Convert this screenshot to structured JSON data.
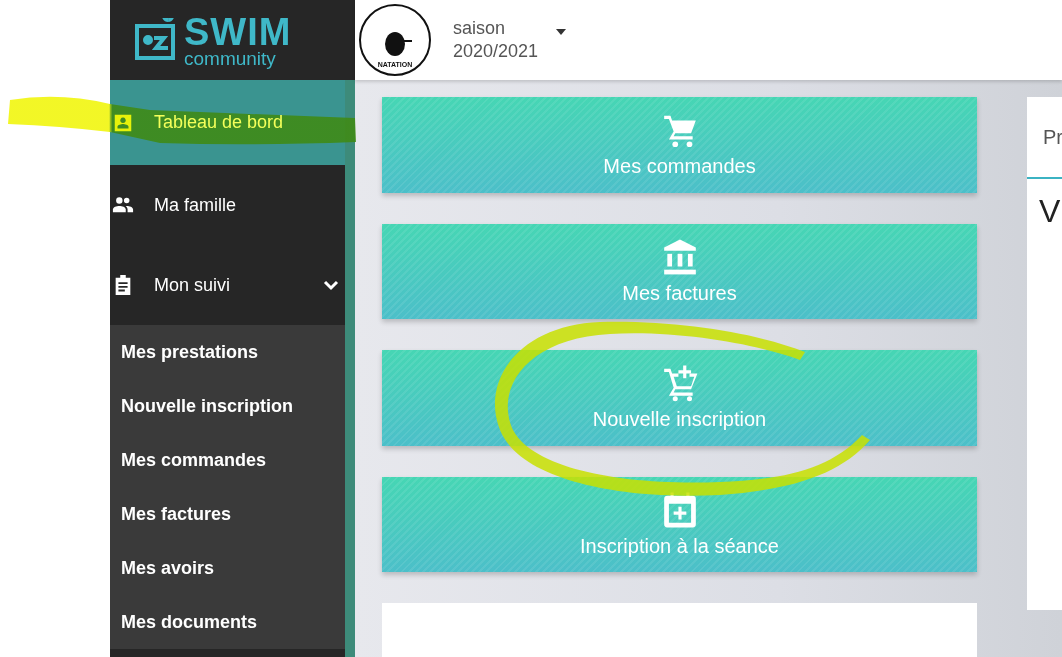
{
  "brand": {
    "name": "SWIM",
    "tagline": "community"
  },
  "club_logo": {
    "text": "NATATION"
  },
  "season": {
    "label": "saison",
    "value": "2020/2021"
  },
  "sidebar": {
    "items": [
      {
        "label": "Tableau de bord",
        "kind": "dashboard",
        "selected": true,
        "highlighted": true
      },
      {
        "label": "Ma famille",
        "kind": "family",
        "selected": false,
        "highlighted": false
      },
      {
        "label": "Mon suivi",
        "kind": "tracking",
        "selected": false,
        "highlighted": false,
        "expanded": true,
        "children": [
          {
            "label": "Mes prestations"
          },
          {
            "label": "Nouvelle inscription"
          },
          {
            "label": "Mes commandes"
          },
          {
            "label": "Mes factures"
          },
          {
            "label": "Mes avoirs"
          },
          {
            "label": "Mes documents"
          }
        ]
      }
    ]
  },
  "tiles": [
    {
      "label": "Mes commandes",
      "kind": "orders",
      "circled": false
    },
    {
      "label": "Mes factures",
      "kind": "invoices",
      "circled": false
    },
    {
      "label": "Nouvelle inscription",
      "kind": "registration",
      "circled": true
    },
    {
      "label": "Inscription à la séance",
      "kind": "session",
      "circled": false
    }
  ],
  "side_card": {
    "tab": "Pr",
    "heading": "V"
  }
}
